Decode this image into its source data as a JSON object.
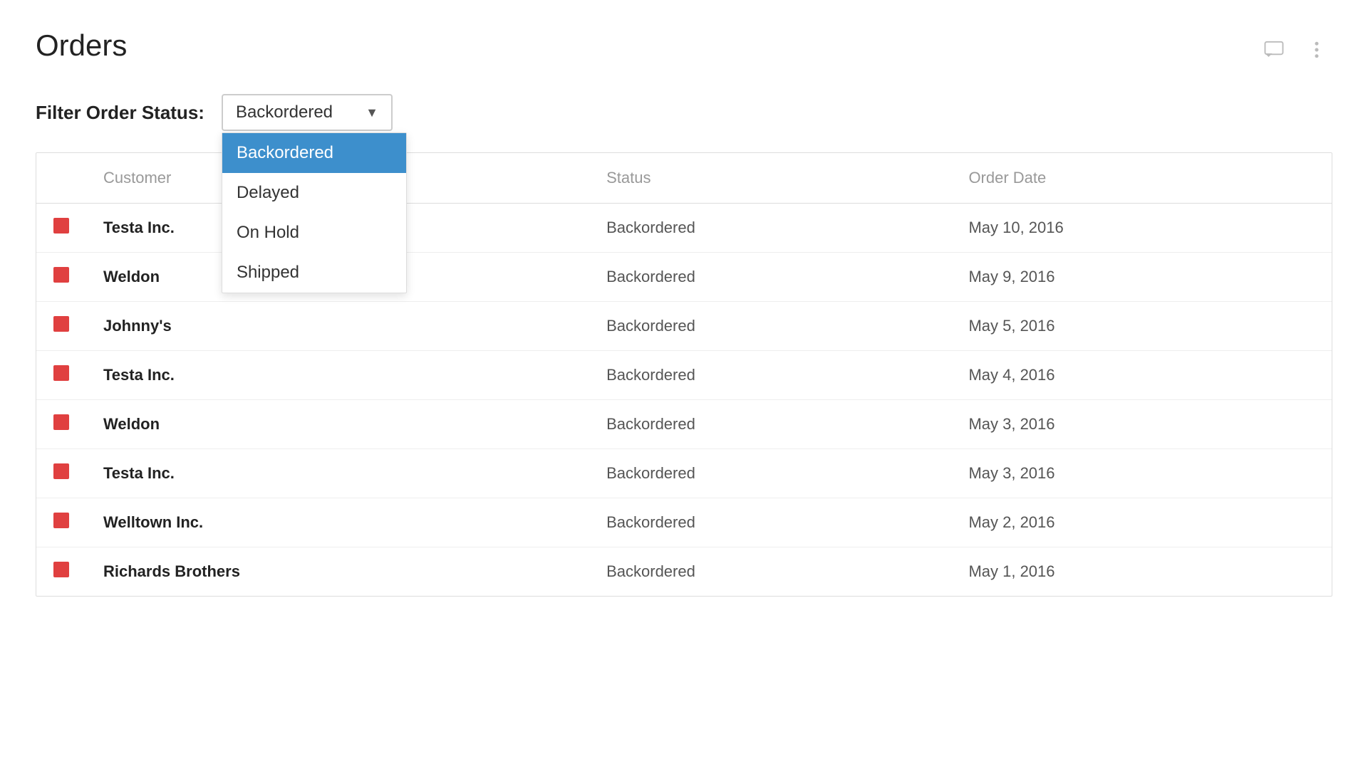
{
  "page": {
    "title": "Orders"
  },
  "header": {
    "chat_icon": "chat-icon",
    "more_icon": "more-icon"
  },
  "filter": {
    "label": "Filter Order Status:",
    "selected": "Backordered",
    "options": [
      {
        "label": "Backordered",
        "selected": true
      },
      {
        "label": "Delayed",
        "selected": false
      },
      {
        "label": "On Hold",
        "selected": false
      },
      {
        "label": "Shipped",
        "selected": false
      }
    ]
  },
  "table": {
    "columns": [
      "",
      "Customer",
      "Status",
      "Order Date"
    ],
    "rows": [
      {
        "customer": "Testa Inc.",
        "status": "Backordered",
        "date": "May 10, 2016"
      },
      {
        "customer": "Weldon",
        "status": "Backordered",
        "date": "May 9, 2016"
      },
      {
        "customer": "Johnny's",
        "status": "Backordered",
        "date": "May 5, 2016"
      },
      {
        "customer": "Testa Inc.",
        "status": "Backordered",
        "date": "May 4, 2016"
      },
      {
        "customer": "Weldon",
        "status": "Backordered",
        "date": "May 3, 2016"
      },
      {
        "customer": "Testa Inc.",
        "status": "Backordered",
        "date": "May 3, 2016"
      },
      {
        "customer": "Welltown Inc.",
        "status": "Backordered",
        "date": "May 2, 2016"
      },
      {
        "customer": "Richards Brothers",
        "status": "Backordered",
        "date": "May 1, 2016"
      }
    ]
  },
  "colors": {
    "status_icon": "#e04040",
    "selected_bg": "#3d8fcc",
    "selected_text": "#ffffff"
  }
}
